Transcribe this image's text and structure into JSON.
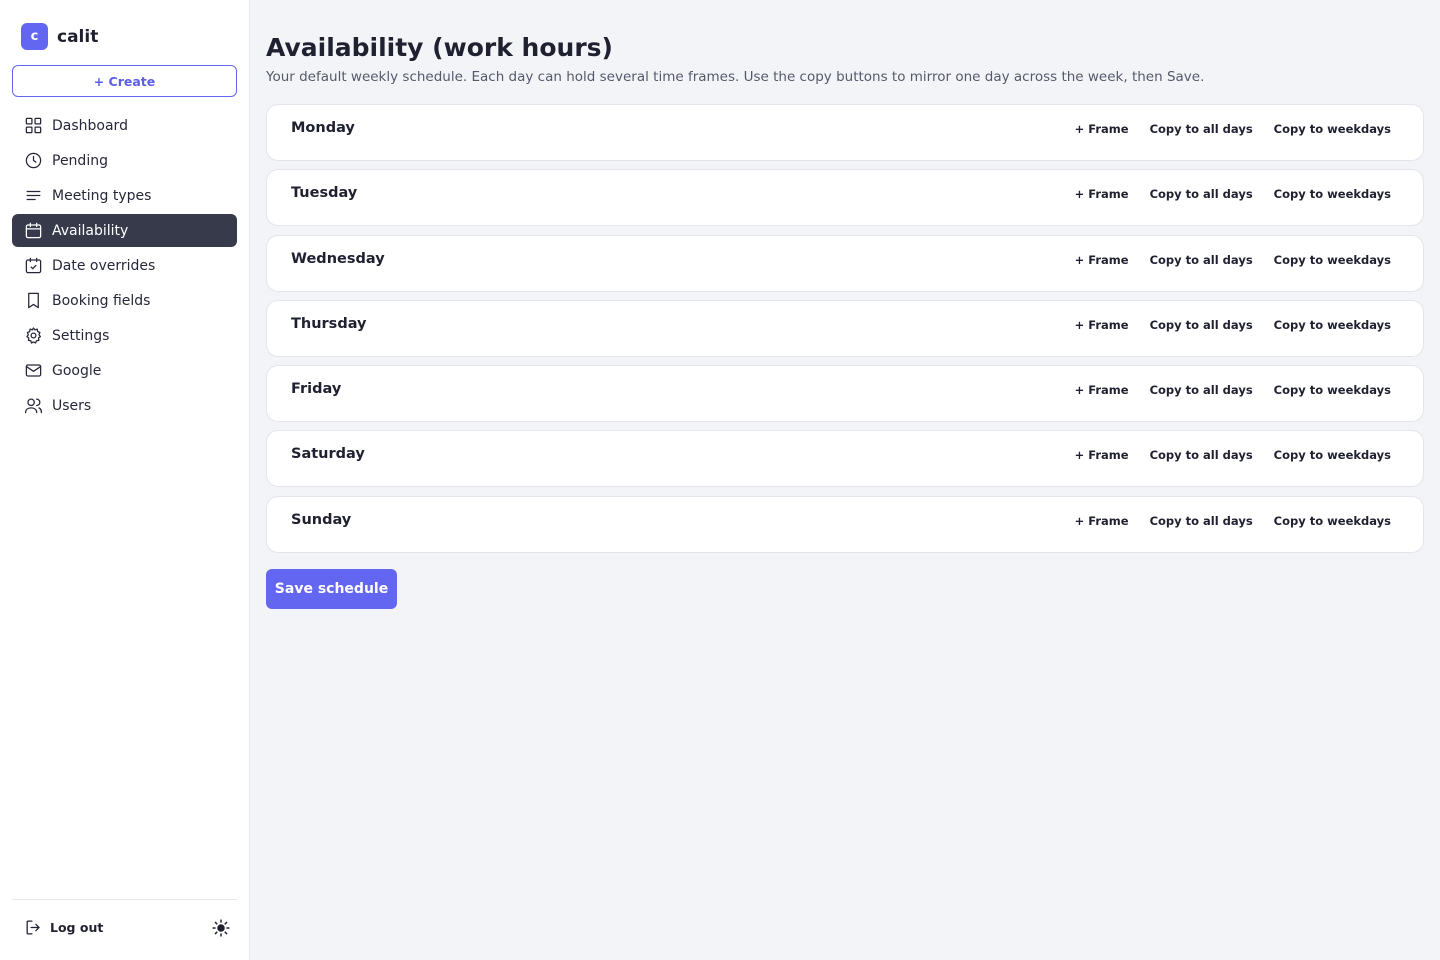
{
  "brand": {
    "logo_letter": "c",
    "name": "calit",
    "accent": "#6366f1"
  },
  "sidebar": {
    "create_label": "+ Create",
    "items": [
      {
        "label": "Dashboard",
        "icon": "grid-icon",
        "active": false
      },
      {
        "label": "Pending",
        "icon": "clock-icon",
        "active": false
      },
      {
        "label": "Meeting types",
        "icon": "list-icon",
        "active": false
      },
      {
        "label": "Availability",
        "icon": "calendar-icon",
        "active": true
      },
      {
        "label": "Date overrides",
        "icon": "calendar-check-icon",
        "active": false
      },
      {
        "label": "Booking fields",
        "icon": "bookmark-icon",
        "active": false
      },
      {
        "label": "Settings",
        "icon": "gear-icon",
        "active": false
      },
      {
        "label": "Google",
        "icon": "mail-icon",
        "active": false
      },
      {
        "label": "Users",
        "icon": "users-icon",
        "active": false
      }
    ],
    "logout_label": "Log out",
    "theme_icon": "sun-icon"
  },
  "page": {
    "title": "Availability (work hours)",
    "subtitle": "Your default weekly schedule. Each day can hold several time frames. Use the copy buttons to mirror one day across the week, then Save."
  },
  "day_actions": {
    "add_frame": "+ Frame",
    "copy_all": "Copy to all days",
    "copy_weekdays": "Copy to weekdays"
  },
  "days": [
    "Monday",
    "Tuesday",
    "Wednesday",
    "Thursday",
    "Friday",
    "Saturday",
    "Sunday"
  ],
  "save_label": "Save schedule"
}
